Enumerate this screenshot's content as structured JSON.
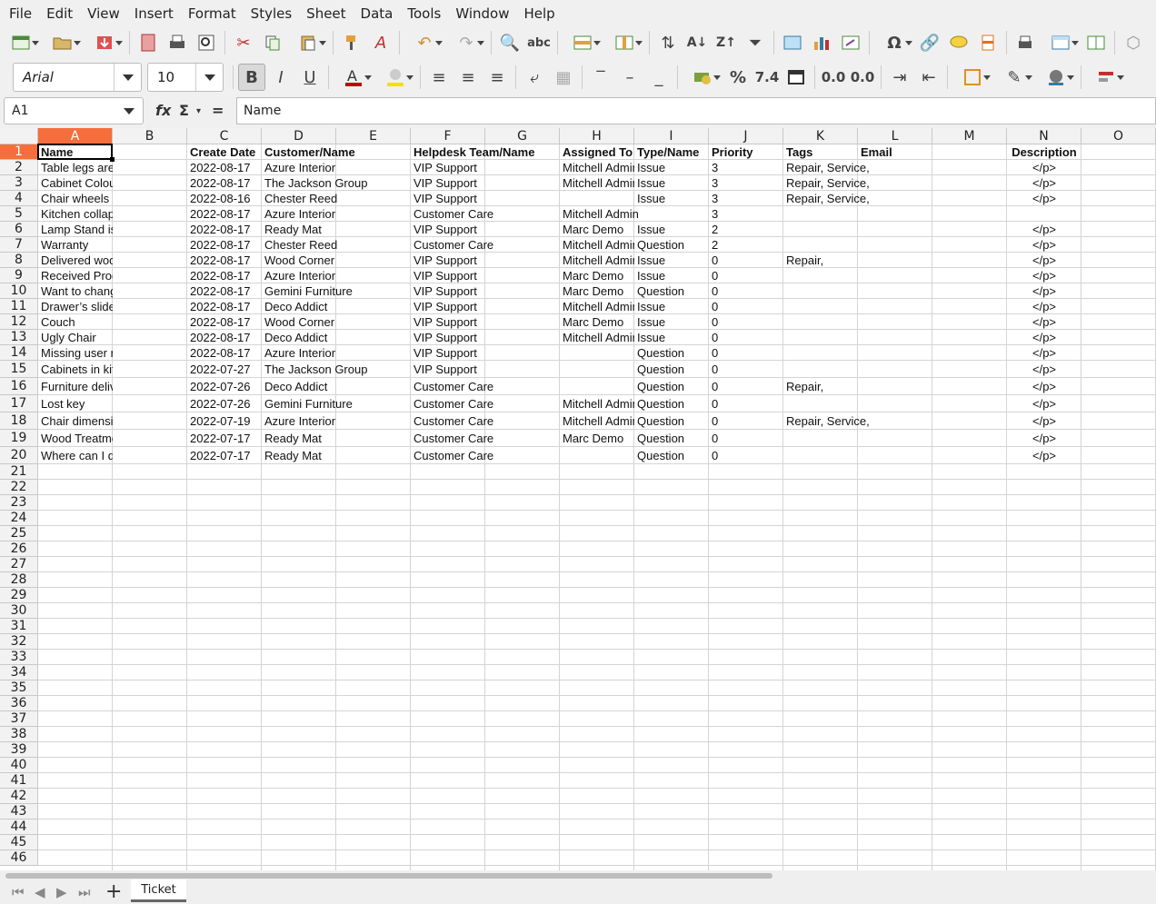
{
  "menu": [
    "File",
    "Edit",
    "View",
    "Insert",
    "Format",
    "Styles",
    "Sheet",
    "Data",
    "Tools",
    "Window",
    "Help"
  ],
  "toolbar2": {
    "font_name": "Arial",
    "font_size": "10"
  },
  "formula": {
    "cell_ref": "A1",
    "content": "Name"
  },
  "columns": [
    "A",
    "B",
    "C",
    "D",
    "E",
    "F",
    "G",
    "H",
    "I",
    "J",
    "K",
    "L",
    "M",
    "N",
    "O"
  ],
  "header_row": {
    "A": "Name",
    "C": "Create Date",
    "D": "Customer/Name",
    "F": "Helpdesk Team/Name",
    "H": "Assigned To",
    "I": "Type/Name",
    "J": "Priority",
    "K": "Tags",
    "L": "Email",
    "N": "Description"
  },
  "rows": [
    {
      "A": "Table legs are unbalanced",
      "C": "2022-08-17",
      "D": "Azure Interior",
      "F": "VIP Support",
      "H": "Mitchell Admin",
      "I": "Issue",
      "J": "3",
      "K": "Repair, Service,",
      "N": "</p>"
    },
    {
      "A": "Cabinet Colour and Lock are",
      "C": "2022-08-17",
      "D": "The Jackson Group",
      "F": "VIP Support",
      "H": "Mitchell Admin",
      "I": "Issue",
      "J": "3",
      "K": "Repair, Service,",
      "N": "</p>"
    },
    {
      "A": "Chair wheels aren’t working",
      "C": "2022-08-16",
      "D": "Chester Reed",
      "F": "VIP Support",
      "H": "",
      "I": "Issue",
      "J": "3",
      "K": "Repair, Service,",
      "N": "</p>"
    },
    {
      "A": "Kitchen collapsing",
      "C": "2022-08-17",
      "D": "Azure Interior",
      "F": "Customer Care",
      "H": "Mitchell Admin",
      "I": "",
      "J": "3",
      "K": "",
      "N": ""
    },
    {
      "A": "Lamp Stand is bent",
      "C": "2022-08-17",
      "D": "Ready Mat",
      "F": "VIP Support",
      "H": "Marc Demo",
      "I": "Issue",
      "J": "2",
      "K": "",
      "N": "</p>"
    },
    {
      "A": "Warranty",
      "C": "2022-08-17",
      "D": "Chester Reed",
      "F": "Customer Care",
      "H": "Mitchell Admin",
      "I": "Question",
      "J": "2",
      "K": "",
      "N": "</p>"
    },
    {
      "A": "Delivered wood panel is not",
      "C": "2022-08-17",
      "D": "Wood Corner",
      "F": "VIP Support",
      "H": "Mitchell Admin",
      "I": "Issue",
      "J": "0",
      "K": "Repair,",
      "N": "</p>"
    },
    {
      "A": "Received Product is damaged",
      "C": "2022-08-17",
      "D": "Azure Interior",
      "F": "VIP Support",
      "H": "Marc Demo",
      "I": "Issue",
      "J": "0",
      "K": "",
      "N": "</p>"
    },
    {
      "A": "Want to change the place of",
      "C": "2022-08-17",
      "D": "Gemini Furniture",
      "F": "VIP Support",
      "H": "Marc Demo",
      "I": "Question",
      "J": "0",
      "K": "",
      "N": "</p>"
    },
    {
      "A": "Drawer’s slides and handles",
      "C": "2022-08-17",
      "D": "Deco Addict",
      "F": "VIP Support",
      "H": "Mitchell Admin",
      "I": "Issue",
      "J": "0",
      "K": "",
      "N": "</p>"
    },
    {
      "A": "Couch",
      "C": "2022-08-17",
      "D": "Wood Corner",
      "F": "VIP Support",
      "H": "Marc Demo",
      "I": "Issue",
      "J": "0",
      "K": "",
      "N": "</p>"
    },
    {
      "A": "Ugly Chair",
      "C": "2022-08-17",
      "D": "Deco Addict",
      "F": "VIP Support",
      "H": "Mitchell Admin",
      "I": "Issue",
      "J": "0",
      "K": "",
      "N": "</p>"
    },
    {
      "A": "Missing user manual",
      "C": "2022-08-17",
      "D": "Azure Interior",
      "F": "VIP Support",
      "H": "",
      "I": "Question",
      "J": "0",
      "K": "",
      "N": "</p>"
    },
    {
      "A": "Cabinets in kit",
      "C": "2022-07-27",
      "D": "The Jackson Group",
      "F": "VIP Support",
      "H": "",
      "I": "Question",
      "J": "0",
      "K": "",
      "N": "</p>"
    },
    {
      "A": "Furniture delivery",
      "C": "2022-07-26",
      "D": "Deco Addict",
      "F": "Customer Care",
      "H": "",
      "I": "Question",
      "J": "0",
      "K": "Repair,",
      "N": "</p>"
    },
    {
      "A": "Lost key",
      "C": "2022-07-26",
      "D": "Gemini Furniture",
      "F": "Customer Care",
      "H": "Mitchell Admin",
      "I": "Question",
      "J": "0",
      "K": "",
      "N": "</p>"
    },
    {
      "A": "Chair dimensions",
      "C": "2022-07-19",
      "D": "Azure Interior",
      "F": "Customer Care",
      "H": "Mitchell Admin",
      "I": "Question",
      "J": "0",
      "K": "Repair, Service,",
      "N": "</p>"
    },
    {
      "A": "Wood Treatment",
      "C": "2022-07-17",
      "D": "Ready Mat",
      "F": "Customer Care",
      "H": "Marc Demo",
      "I": "Question",
      "J": "0",
      "K": "",
      "N": "</p>"
    },
    {
      "A": "Where can I download a catalog",
      "C": "2022-07-17",
      "D": "Ready Mat",
      "F": "Customer Care",
      "H": "",
      "I": "Question",
      "J": "0",
      "K": "",
      "N": "</p>"
    }
  ],
  "row_numbers": [
    "1",
    "2",
    "3",
    "4",
    "5",
    "6",
    "7",
    "8",
    "9",
    "10",
    "11",
    "12",
    "13",
    "14",
    "15",
    "16",
    "17",
    "18",
    "19",
    "20",
    "21",
    "22",
    "23",
    "24",
    "25",
    "26",
    "27",
    "28",
    "29",
    "30",
    "31",
    "32",
    "33",
    "34",
    "35",
    "36",
    "37",
    "38",
    "39",
    "40",
    "41",
    "42",
    "43",
    "44",
    "45",
    "46"
  ],
  "sheet_tab": "Ticket",
  "accent_color": "#f56e3c"
}
